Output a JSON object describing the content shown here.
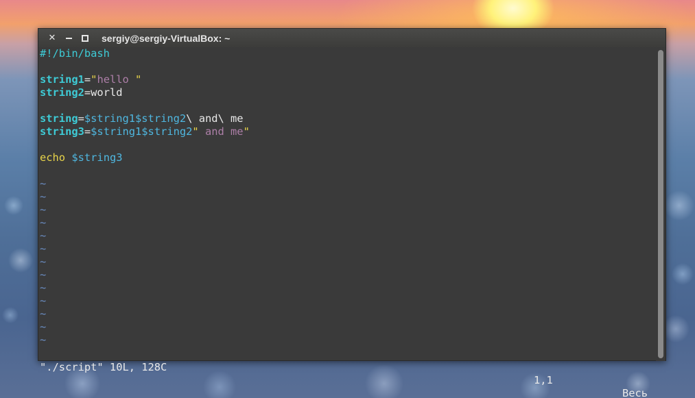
{
  "window": {
    "title": "sergiy@sergiy-VirtualBox: ~",
    "close_glyph": "✕"
  },
  "editor": {
    "shebang": "#!/bin/bash",
    "line3": {
      "var": "string1",
      "eq": "=",
      "q1": "\"",
      "str": "hello ",
      "q2": "\""
    },
    "line4": {
      "var": "string2",
      "eq": "=",
      "val": "world"
    },
    "line6": {
      "var": "string",
      "eq": "=",
      "ref": "$string1$string2",
      "rest": "\\ and\\ me"
    },
    "line7": {
      "var": "string3",
      "eq": "=",
      "ref": "$string1$string2",
      "q1": "\"",
      "str": " and me",
      "q2": "\""
    },
    "line9": {
      "cmd": "echo",
      "sp": " ",
      "ref": "$string3"
    },
    "tilde": "~",
    "tilde_count": 13
  },
  "status": {
    "file": "\"./script\" 10L, 128C",
    "position": "1,1",
    "scroll": "Весь"
  },
  "colors": {
    "background": "#3a3a3a",
    "cyan": "#3ecbd6",
    "string": "#ad7fa8",
    "yellow": "#e8d44a",
    "tilde": "#6b8ec4"
  },
  "icons": {
    "close": "close-icon",
    "minimize": "minimize-icon",
    "maximize": "maximize-icon"
  }
}
